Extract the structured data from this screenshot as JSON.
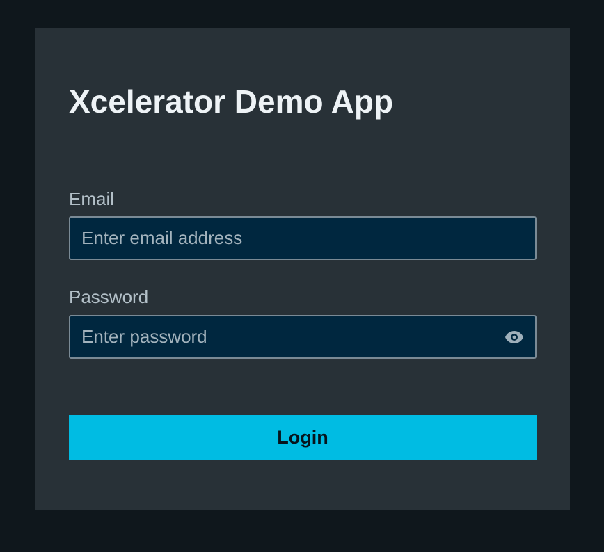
{
  "app": {
    "title": "Xcelerator Demo App"
  },
  "form": {
    "email": {
      "label": "Email",
      "value": "",
      "placeholder": "Enter email address"
    },
    "password": {
      "label": "Password",
      "value": "",
      "placeholder": "Enter password",
      "toggle_icon": "eye-icon"
    },
    "login_label": "Login"
  },
  "colors": {
    "page_background": "#0f171c",
    "card_background": "#283137",
    "input_background": "#00273f",
    "input_border": "#7a8a95",
    "accent": "#00bce3",
    "title_text": "#eef3f6",
    "label_text": "#b3c0c8"
  }
}
